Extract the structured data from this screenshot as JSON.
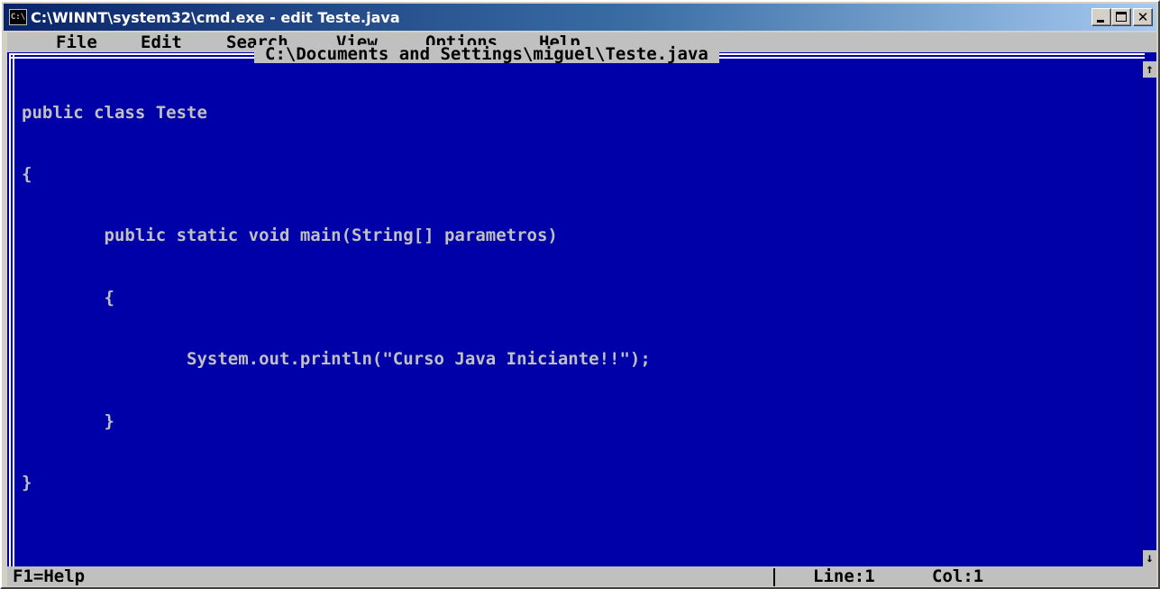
{
  "window": {
    "title": "C:\\WINNT\\system32\\cmd.exe - edit Teste.java",
    "icon_text": "C:\\"
  },
  "menu": {
    "items": [
      "File",
      "Edit",
      "Search",
      "View",
      "Options",
      "Help"
    ]
  },
  "editor": {
    "file_path": "C:\\Documents and Settings\\miguel\\Teste.java",
    "lines": [
      "public class Teste",
      "{",
      "        public static void main(String[] parametros)",
      "        {",
      "                System.out.println(\"Curso Java Iniciante!!\");",
      "        }",
      "}"
    ]
  },
  "status": {
    "help": "F1=Help",
    "line": "Line:1",
    "col": "Col:1"
  },
  "colors": {
    "editor_background": "#0000a8",
    "editor_text": "#c0c0c0",
    "menu_background": "#c0c0c0"
  }
}
